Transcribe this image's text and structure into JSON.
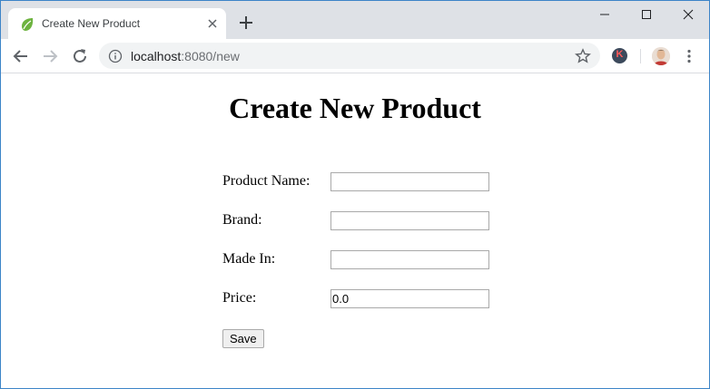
{
  "browser": {
    "tab_title": "Create New Product",
    "url_host": "localhost",
    "url_rest": ":8080/new",
    "extension_letter": "K"
  },
  "page": {
    "title": "Create New Product",
    "fields": [
      {
        "label": "Product Name:",
        "value": ""
      },
      {
        "label": "Brand:",
        "value": ""
      },
      {
        "label": "Made In:",
        "value": ""
      },
      {
        "label": "Price:",
        "value": "0.0"
      }
    ],
    "save_label": "Save"
  },
  "colors": {
    "tabstrip": "#dee1e6",
    "omnibox": "#f1f3f4",
    "spring_leaf": "#6db33f"
  },
  "icons": [
    "spring-leaf-icon",
    "close-icon",
    "plus-icon",
    "minimize-icon",
    "maximize-icon",
    "window-close-icon",
    "back-arrow-icon",
    "forward-arrow-icon",
    "reload-icon",
    "info-icon",
    "star-icon",
    "kebab-menu-icon"
  ]
}
